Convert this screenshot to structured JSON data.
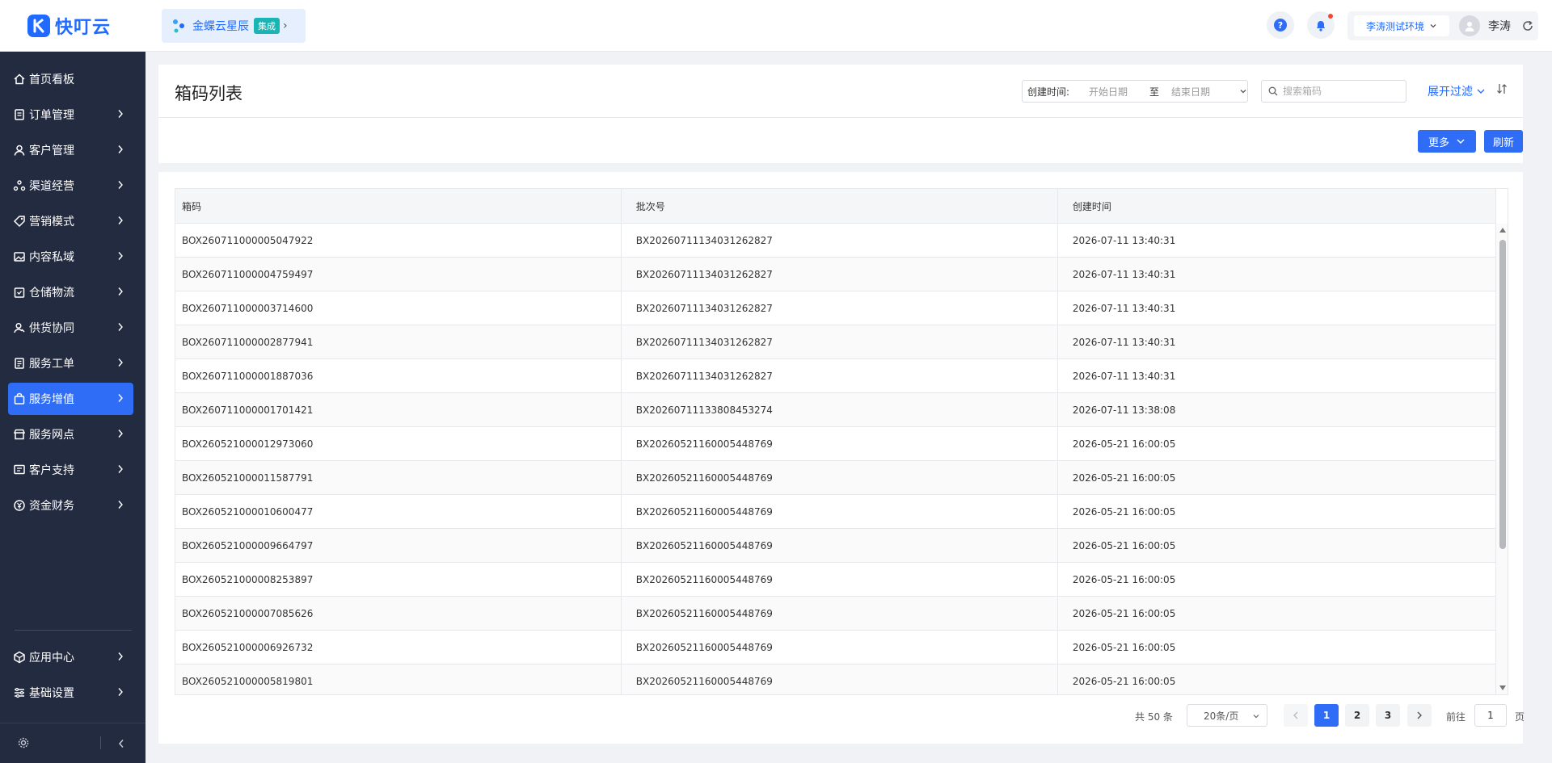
{
  "header": {
    "logo_text": "快叮云",
    "integration": {
      "name": "金蝶云星辰",
      "badge": "集成"
    },
    "environment": "李涛测试环境",
    "user_name": "李涛"
  },
  "sidebar": {
    "items": [
      {
        "label": "首页看板",
        "icon": "home-icon",
        "has_chevron": false,
        "active": false
      },
      {
        "label": "订单管理",
        "icon": "order-icon",
        "has_chevron": true,
        "active": false
      },
      {
        "label": "客户管理",
        "icon": "customer-icon",
        "has_chevron": true,
        "active": false
      },
      {
        "label": "渠道经营",
        "icon": "channel-icon",
        "has_chevron": true,
        "active": false
      },
      {
        "label": "营销模式",
        "icon": "tag-icon",
        "has_chevron": true,
        "active": false
      },
      {
        "label": "内容私域",
        "icon": "image-icon",
        "has_chevron": true,
        "active": false
      },
      {
        "label": "仓储物流",
        "icon": "warehouse-icon",
        "has_chevron": true,
        "active": false
      },
      {
        "label": "供货协同",
        "icon": "supply-icon",
        "has_chevron": true,
        "active": false
      },
      {
        "label": "服务工单",
        "icon": "ticket-icon",
        "has_chevron": true,
        "active": false
      },
      {
        "label": "服务增值",
        "icon": "bag-icon",
        "has_chevron": true,
        "active": true
      },
      {
        "label": "服务网点",
        "icon": "store-icon",
        "has_chevron": true,
        "active": false
      },
      {
        "label": "客户支持",
        "icon": "support-icon",
        "has_chevron": true,
        "active": false
      },
      {
        "label": "资金财务",
        "icon": "finance-icon",
        "has_chevron": true,
        "active": false
      }
    ],
    "bottom_items": [
      {
        "label": "应用中心",
        "icon": "app-center-icon"
      },
      {
        "label": "基础设置",
        "icon": "settings-list-icon"
      }
    ]
  },
  "main": {
    "title": "箱码列表",
    "filter": {
      "date_label": "创建时间:",
      "start_placeholder": "开始日期",
      "separator": "至",
      "end_placeholder": "结束日期",
      "search_placeholder": "搜索箱码",
      "expand_label": "展开过滤"
    },
    "more_label": "更多",
    "refresh_label": "刷新",
    "table": {
      "columns": [
        "箱码",
        "批次号",
        "创建时间"
      ],
      "rows": [
        [
          "BOX260711000005047922",
          "BX20260711134031262827",
          "2026-07-11 13:40:31"
        ],
        [
          "BOX260711000004759497",
          "BX20260711134031262827",
          "2026-07-11 13:40:31"
        ],
        [
          "BOX260711000003714600",
          "BX20260711134031262827",
          "2026-07-11 13:40:31"
        ],
        [
          "BOX260711000002877941",
          "BX20260711134031262827",
          "2026-07-11 13:40:31"
        ],
        [
          "BOX260711000001887036",
          "BX20260711134031262827",
          "2026-07-11 13:40:31"
        ],
        [
          "BOX260711000001701421",
          "BX20260711133808453274",
          "2026-07-11 13:38:08"
        ],
        [
          "BOX260521000012973060",
          "BX20260521160005448769",
          "2026-05-21 16:00:05"
        ],
        [
          "BOX260521000011587791",
          "BX20260521160005448769",
          "2026-05-21 16:00:05"
        ],
        [
          "BOX260521000010600477",
          "BX20260521160005448769",
          "2026-05-21 16:00:05"
        ],
        [
          "BOX260521000009664797",
          "BX20260521160005448769",
          "2026-05-21 16:00:05"
        ],
        [
          "BOX260521000008253897",
          "BX20260521160005448769",
          "2026-05-21 16:00:05"
        ],
        [
          "BOX260521000007085626",
          "BX20260521160005448769",
          "2026-05-21 16:00:05"
        ],
        [
          "BOX260521000006926732",
          "BX20260521160005448769",
          "2026-05-21 16:00:05"
        ],
        [
          "BOX260521000005819801",
          "BX20260521160005448769",
          "2026-05-21 16:00:05"
        ]
      ]
    },
    "pagination": {
      "total_text": "共 50 条",
      "page_size": "20条/页",
      "pages": [
        "1",
        "2",
        "3"
      ],
      "current_page": "1",
      "goto_label": "前往",
      "goto_value": "1",
      "goto_unit": "页"
    }
  },
  "colors": {
    "accent": "#2f6df6",
    "sidebar_bg": "#232b40",
    "badge": "#19b4b4",
    "notification": "#f5492d"
  }
}
